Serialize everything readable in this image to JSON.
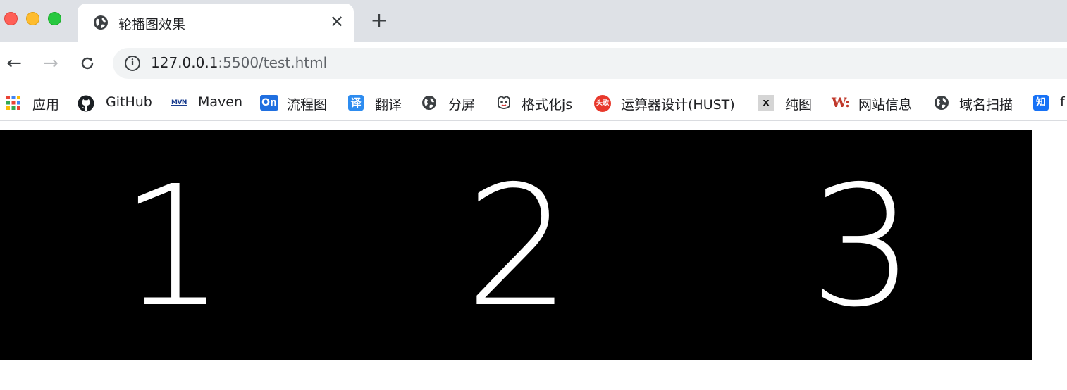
{
  "tab": {
    "title": "轮播图效果",
    "close_symbol": "✕",
    "favicon": "globe-icon"
  },
  "new_tab_symbol": "+",
  "toolbar": {
    "back_symbol": "←",
    "forward_symbol": "→",
    "reload_symbol": "C",
    "info_symbol": "i",
    "url_host": "127.0.0.1",
    "url_rest": ":5500/test.html"
  },
  "bookmarks": [
    {
      "label": "应用",
      "icon": "apps-grid-icon"
    },
    {
      "label": "GitHub",
      "icon": "github-icon"
    },
    {
      "label": "Maven",
      "icon": "maven-icon",
      "icon_text": "MVN"
    },
    {
      "label": "流程图",
      "icon": "processon-icon",
      "icon_text": "On"
    },
    {
      "label": "翻译",
      "icon": "translate-icon",
      "icon_text": "译"
    },
    {
      "label": "分屏",
      "icon": "globe-icon"
    },
    {
      "label": "格式化js",
      "icon": "formatter-icon"
    },
    {
      "label": "运算器设计(HUST)",
      "icon": "toutiao-icon",
      "icon_text": "头歌"
    },
    {
      "label": "纯图",
      "icon": "x-icon",
      "icon_text": "x"
    },
    {
      "label": "网站信息",
      "icon": "w-icon",
      "icon_text": "W:"
    },
    {
      "label": "域名扫描",
      "icon": "globe-icon"
    },
    {
      "label": "f",
      "icon": "zhihu-icon",
      "icon_text": "知"
    }
  ],
  "carousel": {
    "slides": [
      "1",
      "2",
      "3"
    ]
  },
  "colors": {
    "tabstrip_bg": "#dee1e6",
    "carousel_bg": "#000000",
    "slide_text": "#ffffff",
    "processon": "#1f6fe0",
    "translate": "#2d8cf0",
    "toutiao": "#e8382b",
    "w_logo": "#c0392b",
    "zhihu": "#1772f6"
  }
}
